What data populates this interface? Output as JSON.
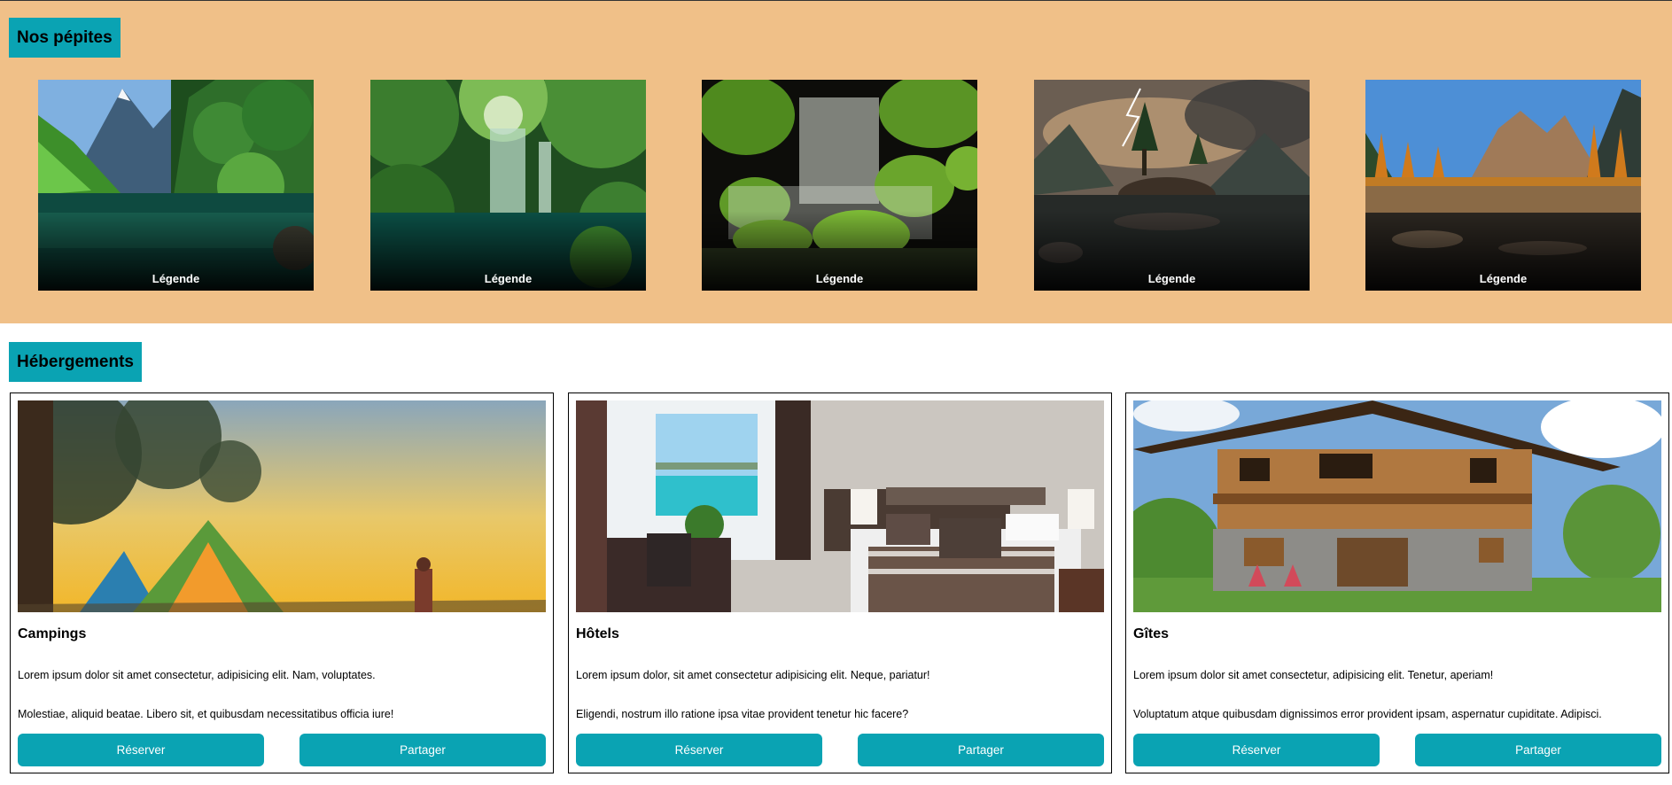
{
  "pepites": {
    "title": "Nos pépites",
    "items": [
      {
        "caption": "Légende",
        "scene": "mountain-lake"
      },
      {
        "caption": "Légende",
        "scene": "forest-waterfall"
      },
      {
        "caption": "Légende",
        "scene": "mossy-cascade"
      },
      {
        "caption": "Légende",
        "scene": "stormy-lake-island"
      },
      {
        "caption": "Légende",
        "scene": "autumn-mountain-lake"
      }
    ]
  },
  "hebergements": {
    "title": "Hébergements",
    "cards": [
      {
        "title": "Campings",
        "text1": "Lorem ipsum dolor sit amet consectetur, adipisicing elit. Nam, voluptates.",
        "text2": "Molestiae, aliquid beatae. Libero sit, et quibusdam necessitatibus officia iure!",
        "reserve_label": "Réserver",
        "share_label": "Partager"
      },
      {
        "title": "Hôtels",
        "text1": "Lorem ipsum dolor, sit amet consectetur adipisicing elit. Neque, pariatur!",
        "text2": "Eligendi, nostrum illo ratione ipsa vitae provident tenetur hic facere?",
        "reserve_label": "Réserver",
        "share_label": "Partager"
      },
      {
        "title": "Gîtes",
        "text1": "Lorem ipsum dolor sit amet consectetur, adipisicing elit. Tenetur, aperiam!",
        "text2": "Voluptatum atque quibusdam dignissimos error provident ipsam, aspernatur cupiditate. Adipisci.",
        "reserve_label": "Réserver",
        "share_label": "Partager"
      }
    ]
  },
  "colors": {
    "pepites_background": "#f0c088",
    "accent": "#0aa3b3"
  }
}
